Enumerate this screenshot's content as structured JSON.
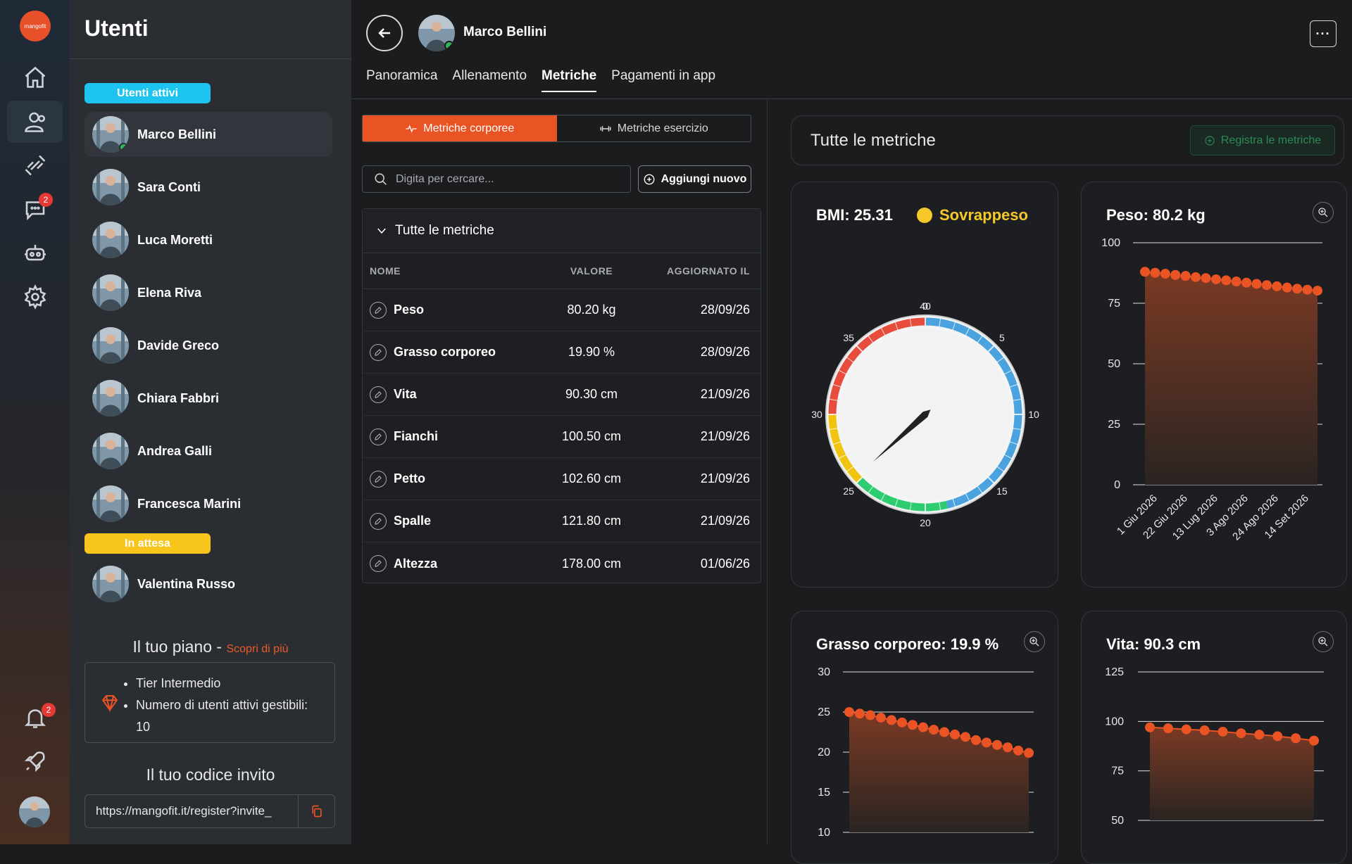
{
  "rail": {
    "logo_text": "mangofit",
    "messages_badge": "2",
    "notifications_badge": "2"
  },
  "users": {
    "title": "Utenti",
    "active_label": "Utenti attivi",
    "pending_label": "In attesa",
    "active": [
      {
        "name": "Marco Bellini",
        "selected": true,
        "online": true
      },
      {
        "name": "Sara Conti"
      },
      {
        "name": "Luca Moretti"
      },
      {
        "name": "Elena Riva"
      },
      {
        "name": "Davide Greco"
      },
      {
        "name": "Chiara Fabbri"
      },
      {
        "name": "Andrea Galli"
      },
      {
        "name": "Francesca Marini"
      }
    ],
    "pending": [
      {
        "name": "Valentina Russo"
      }
    ]
  },
  "plan": {
    "title": "Il tuo piano",
    "separator": " - ",
    "link": "Scopri di più",
    "items": [
      "Tier Intermedio",
      "Numero di utenti attivi gestibili: 10"
    ]
  },
  "invite": {
    "title": "Il tuo codice invito",
    "value": "https://mangofit.it/register?invite_"
  },
  "header": {
    "name": "Marco Bellini",
    "more": "···"
  },
  "tabs": [
    "Panoramica",
    "Allenamento",
    "Metriche",
    "Pagamenti in app"
  ],
  "active_tab": "Metriche",
  "segments": {
    "body": "Metriche corporee",
    "exercise": "Metriche esercizio",
    "selected": "body"
  },
  "search": {
    "placeholder": "Digita per cercare..."
  },
  "add_button": "Aggiungi nuovo",
  "table": {
    "group_title": "Tutte le metriche",
    "columns": [
      "NOME",
      "VALORE",
      "AGGIORNATO IL"
    ],
    "rows": [
      {
        "name": "Peso",
        "value": "80.20 kg",
        "date": "28/09/26"
      },
      {
        "name": "Grasso corporeo",
        "value": "19.90 %",
        "date": "28/09/26"
      },
      {
        "name": "Vita",
        "value": "90.30 cm",
        "date": "21/09/26"
      },
      {
        "name": "Fianchi",
        "value": "100.50 cm",
        "date": "21/09/26"
      },
      {
        "name": "Petto",
        "value": "102.60 cm",
        "date": "21/09/26"
      },
      {
        "name": "Spalle",
        "value": "121.80 cm",
        "date": "21/09/26"
      },
      {
        "name": "Altezza",
        "value": "178.00 cm",
        "date": "01/06/26"
      }
    ]
  },
  "metrics_panel": {
    "title": "Tutte le metriche",
    "register_button": "Registra le metriche"
  },
  "colors": {
    "accent": "#ea5424",
    "active_blue": "#1ec4f0",
    "pending_yellow": "#f8c51c",
    "overweight": "#f5c92a",
    "online": "#2fb85a"
  },
  "chart_data": [
    {
      "type": "gauge",
      "title": "BMI: 25.31",
      "status": "Sovrappeso",
      "value": 25.31,
      "scale": [
        0,
        40
      ],
      "ticks": [
        "0",
        "5",
        "10",
        "15",
        "20",
        "25",
        "30",
        "35",
        "40"
      ],
      "bands": [
        {
          "from": 0,
          "to": 18.5,
          "color": "#4aa3df"
        },
        {
          "from": 18.5,
          "to": 25,
          "color": "#2ecc71"
        },
        {
          "from": 25,
          "to": 30,
          "color": "#f1c40f"
        },
        {
          "from": 30,
          "to": 40,
          "color": "#e74c3c"
        }
      ]
    },
    {
      "type": "area",
      "title": "Peso: 80.2 kg",
      "ylim": [
        0,
        100
      ],
      "yticks": [
        "0",
        "25",
        "50",
        "75",
        "100"
      ],
      "x_labels": [
        "1 Giu 2026",
        "22 Giu 2026",
        "13 Lug 2026",
        "3 Ago 2026",
        "24 Ago 2026",
        "14 Set 2026"
      ],
      "values": [
        88,
        87.6,
        87.2,
        86.7,
        86.3,
        85.8,
        85.4,
        84.9,
        84.5,
        84,
        83.5,
        83,
        82.5,
        82,
        81.5,
        81,
        80.6,
        80.2
      ]
    },
    {
      "type": "area",
      "title": "Grasso corporeo: 19.9 %",
      "ylim": [
        10,
        30
      ],
      "yticks": [
        "10",
        "15",
        "20",
        "25",
        "30"
      ],
      "values": [
        25,
        24.8,
        24.6,
        24.3,
        24,
        23.7,
        23.4,
        23.1,
        22.8,
        22.5,
        22.2,
        21.9,
        21.5,
        21.2,
        20.9,
        20.6,
        20.2,
        19.9
      ]
    },
    {
      "type": "area",
      "title": "Vita: 90.3 cm",
      "ylim": [
        50,
        125
      ],
      "yticks": [
        "50",
        "75",
        "100",
        "125"
      ],
      "values": [
        97,
        96.5,
        96,
        95.5,
        94.8,
        94,
        93.3,
        92.5,
        91.5,
        90.3
      ]
    }
  ]
}
